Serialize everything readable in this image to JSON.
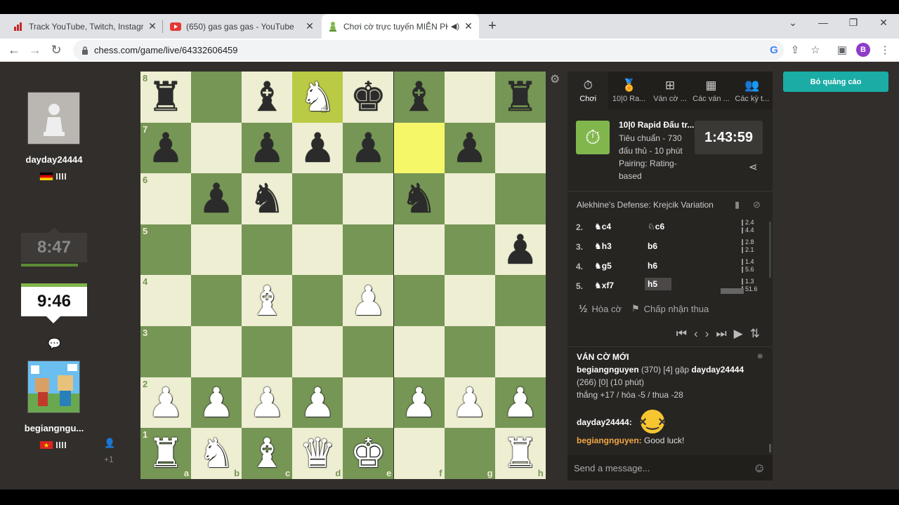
{
  "browser": {
    "tabs": [
      {
        "title": "Track YouTube, Twitch, Instagram",
        "close": "✕"
      },
      {
        "title": "(650) gas gas gas - YouTube",
        "close": "✕"
      },
      {
        "title": "Chơi cờ trực tuyến MIỄN PHÍ",
        "close": "✕"
      }
    ],
    "new_tab": "+",
    "url": "chess.com/game/live/64332606459",
    "profile_initial": "B"
  },
  "left": {
    "top_player": {
      "name": "dayday24444",
      "flag": "Germany"
    },
    "top_clock": "8:47",
    "bottom_clock": "9:46",
    "bottom_player": {
      "name": "begiangngu...",
      "flag": "Vietnam"
    },
    "spectators": "+1"
  },
  "board": {
    "ranks": [
      "8",
      "7",
      "6",
      "5",
      "4",
      "3",
      "2",
      "1"
    ],
    "files": [
      "a",
      "b",
      "c",
      "d",
      "e",
      "f",
      "g",
      "h"
    ],
    "position": [
      [
        "r",
        "",
        "b",
        "N",
        "k",
        "b",
        "",
        "r"
      ],
      [
        "p",
        "",
        "p",
        "p",
        "p",
        "",
        "p",
        ""
      ],
      [
        "",
        "p",
        "n",
        "",
        "",
        "n",
        "",
        ""
      ],
      [
        "",
        "",
        "",
        "",
        "",
        "",
        "",
        "p"
      ],
      [
        "",
        "",
        "B",
        "",
        "P",
        "",
        "",
        ""
      ],
      [
        "",
        "",
        "",
        "",
        "",
        "",
        "",
        ""
      ],
      [
        "P",
        "P",
        "P",
        "P",
        "",
        "P",
        "P",
        "P"
      ],
      [
        "R",
        "N",
        "B",
        "Q",
        "K",
        "",
        "",
        "R"
      ]
    ],
    "highlight_from": "f7",
    "highlight_to": "d8"
  },
  "panel": {
    "tabs": [
      {
        "icon": "stopwatch-icon",
        "label": "Chơi"
      },
      {
        "icon": "medal-icon",
        "label": "10|0 Ra..."
      },
      {
        "icon": "plus-icon",
        "label": "Ván cờ ..."
      },
      {
        "icon": "board-icon",
        "label": "Các ván ..."
      },
      {
        "icon": "players-icon",
        "label": "Các kỳ t..."
      }
    ],
    "game_title": "10|0 Rapid Đấu tr...",
    "game_sub": "Tiêu chuẩn - 730 đấu thủ - 10 phút Pairing: Rating-based",
    "timer": "1:43:59",
    "opening": "Alekhine's Defense: Krejcik Variation",
    "moves": [
      {
        "n": "2.",
        "w": "c4",
        "b": "c6",
        "t1": "2.4",
        "t2": "4.4"
      },
      {
        "n": "3.",
        "w": "h3",
        "b": "b6",
        "t1": "2.8",
        "t2": "2.1"
      },
      {
        "n": "4.",
        "w": "g5",
        "b": "h6",
        "t1": "1.4",
        "t2": "5.6"
      },
      {
        "n": "5.",
        "w": "xf7",
        "b": "h5",
        "t1": "1.3",
        "t2": "51.6"
      }
    ],
    "draw_label": "Hòa cờ",
    "draw_icon": "½",
    "resign_label": "Chấp nhận thua",
    "chat": {
      "title": "VÁN CỜ MỚI",
      "info_user1": "begiangnguyen",
      "info_rest1": "(370) [4] gặp",
      "info_user2": "dayday24444",
      "info_rest2": "(266) [0] (10 phút)",
      "info_line2": "thắng +17 / hòa -5 / thua -28",
      "msg1_user": "dayday24444:",
      "msg2_user": "begiangnguyen:",
      "msg2_text": "Good luck!"
    },
    "chat_placeholder": "Send a message..."
  },
  "ad_button": "Bỏ quảng cáo"
}
